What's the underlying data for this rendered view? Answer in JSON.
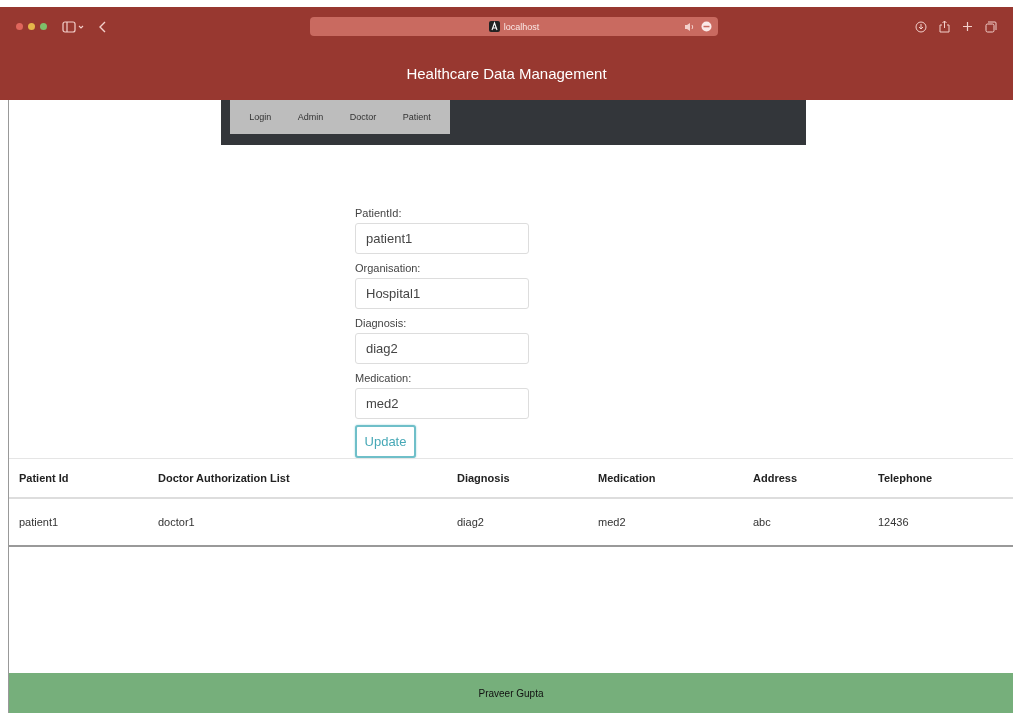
{
  "browser": {
    "address": "localhost"
  },
  "header": {
    "title": "Healthcare Data Management"
  },
  "nav": {
    "items": [
      {
        "label": "Login"
      },
      {
        "label": "Admin"
      },
      {
        "label": "Doctor"
      },
      {
        "label": "Patient"
      }
    ]
  },
  "form": {
    "fields": [
      {
        "label": "PatientId:",
        "value": "patient1"
      },
      {
        "label": "Organisation:",
        "value": "Hospital1"
      },
      {
        "label": "Diagnosis:",
        "value": "diag2"
      },
      {
        "label": "Medication:",
        "value": "med2"
      }
    ],
    "button": "Update"
  },
  "table": {
    "columns": [
      "Patient Id",
      "Doctor Authorization List",
      "Diagnosis",
      "Medication",
      "Address",
      "Telephone"
    ],
    "rows": [
      [
        "patient1",
        "doctor1",
        "diag2",
        "med2",
        "abc",
        "12436"
      ]
    ]
  },
  "footer": {
    "text": "Praveer Gupta"
  }
}
